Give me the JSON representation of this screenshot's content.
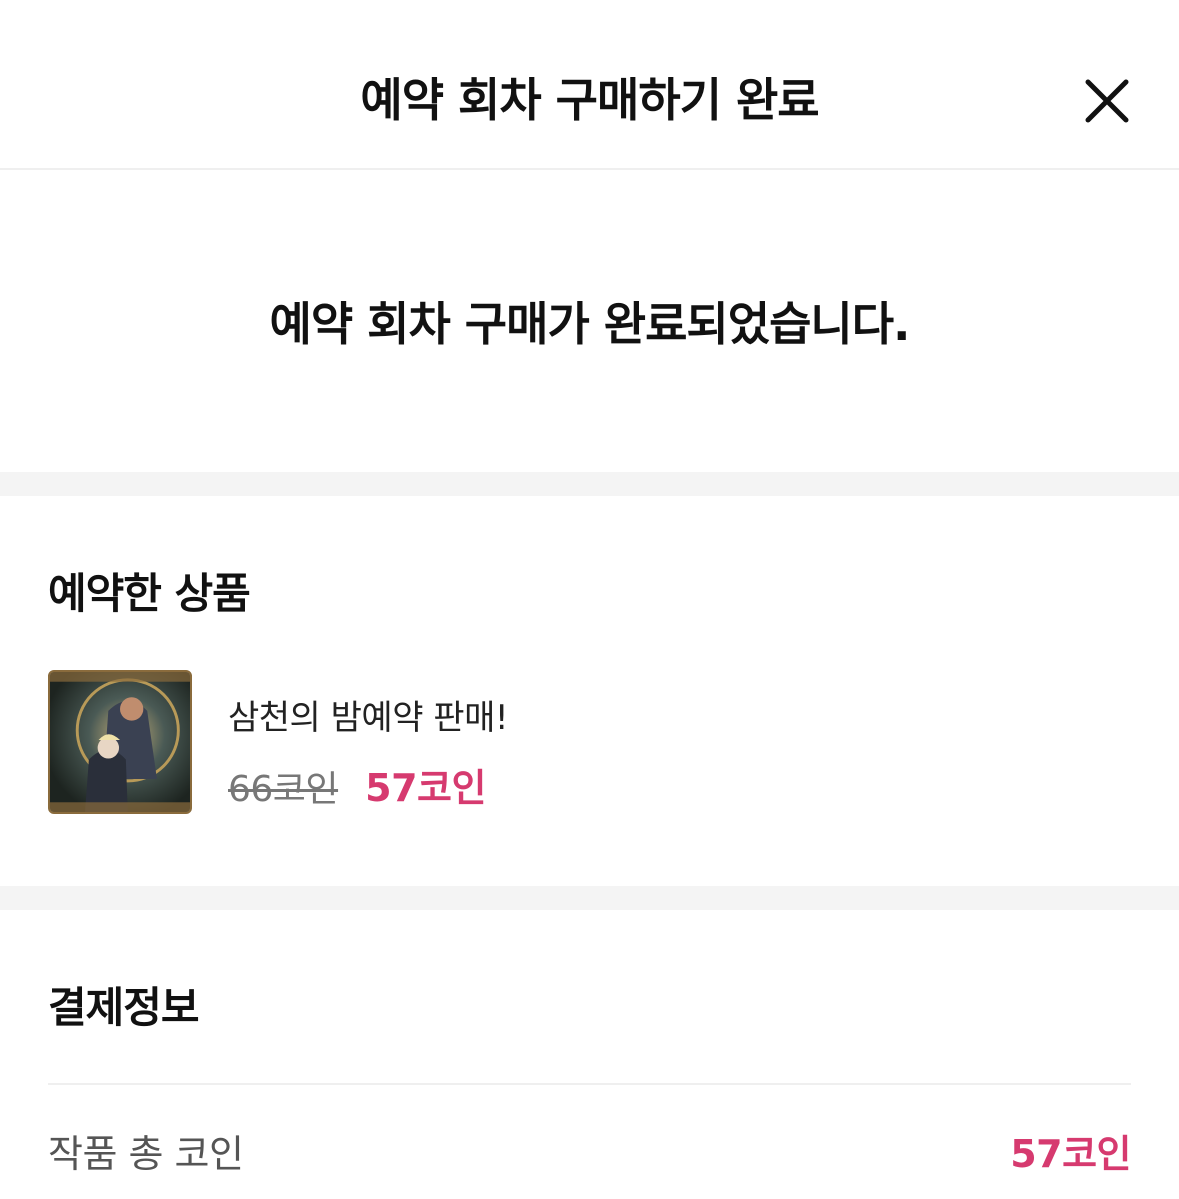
{
  "header": {
    "title": "예약 회차 구매하기 완료",
    "close_icon": "close-icon"
  },
  "message": "예약 회차 구매가 완료되었습니다.",
  "reserved": {
    "section_title": "예약한 상품",
    "product": {
      "name": "삼천의 밤예약 판매!",
      "original_price": "66코인",
      "sale_price": "57코인"
    }
  },
  "payment": {
    "section_title": "결제정보",
    "total_label": "작품 총 코인",
    "total_value": "57코인"
  },
  "colors": {
    "accent": "#d63a6f",
    "band": "#f4f4f4",
    "divider": "#efefef"
  }
}
